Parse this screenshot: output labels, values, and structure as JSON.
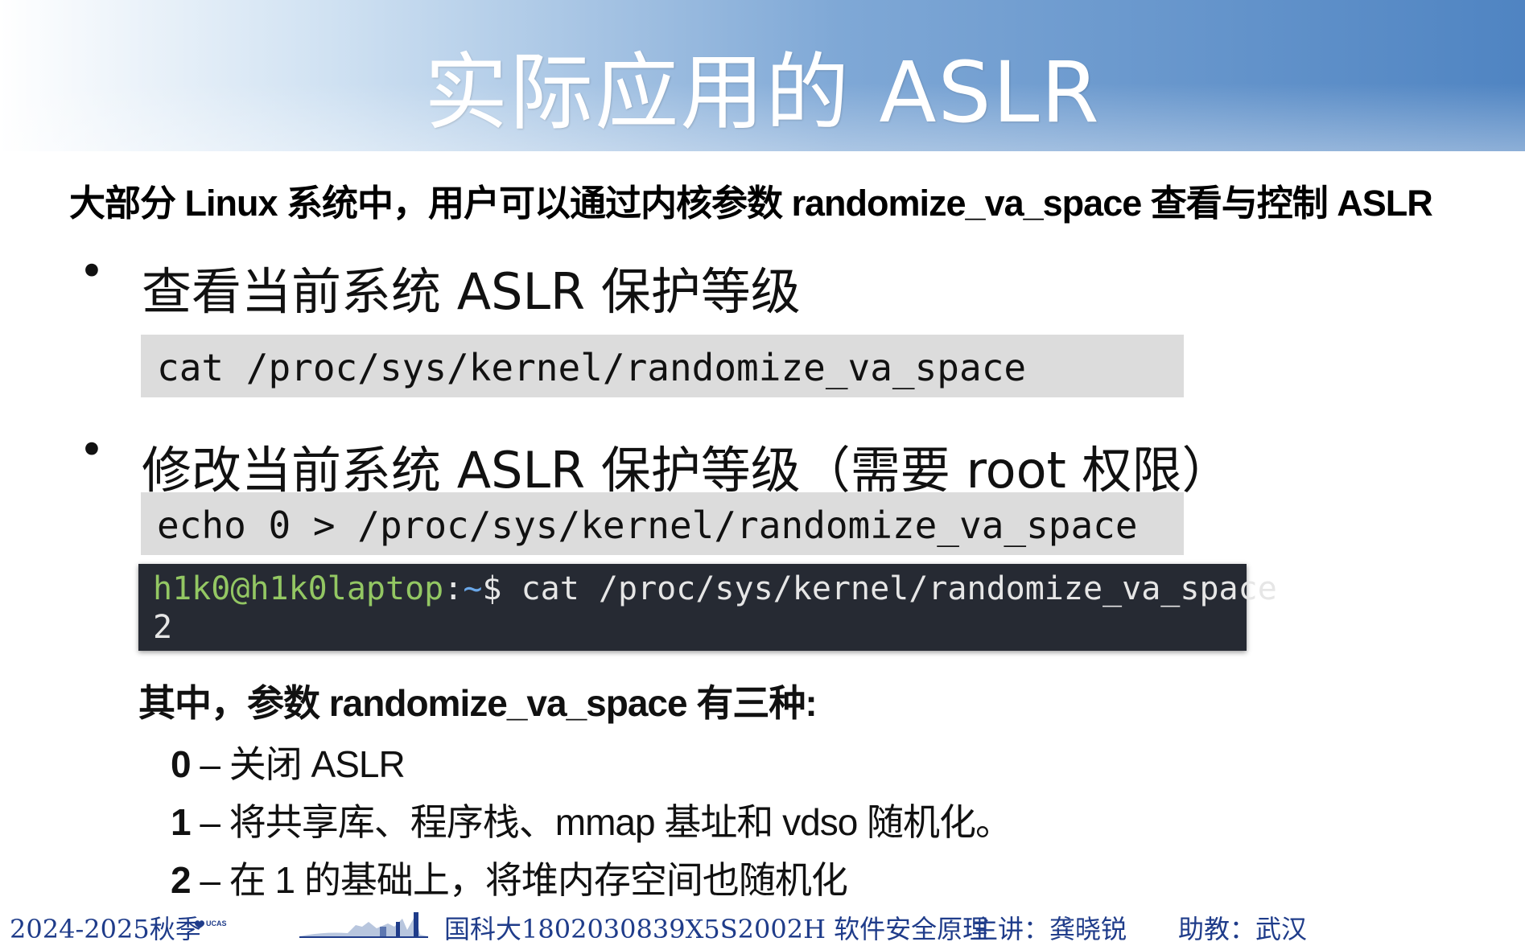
{
  "slide": {
    "title": "实际应用的 ASLR",
    "intro": "大部分 Linux 系统中，用户可以通过内核参数 randomize_va_space 查看与控制 ASLR",
    "bullets": [
      {
        "text": "查看当前系统 ASLR 保护等级",
        "code": "cat /proc/sys/kernel/randomize_va_space"
      },
      {
        "text": "修改当前系统 ASLR 保护等级（需要 root 权限）",
        "code": "echo 0 > /proc/sys/kernel/randomize_va_space"
      }
    ],
    "terminal": {
      "prompt_user": "h1k0@h1k0laptop",
      "prompt_sep": ":",
      "prompt_path": "~",
      "prompt_symbol": "$ ",
      "command": "cat /proc/sys/kernel/randomize_va_space",
      "output": "2"
    },
    "params_heading": "其中，参数 randomize_va_space 有三种:",
    "options": [
      {
        "num": "0",
        "dash": " – ",
        "desc": "关闭 ASLR"
      },
      {
        "num": "1",
        "dash": " – ",
        "desc": "将共享库、程序栈、mmap 基址和 vdso 随机化。"
      },
      {
        "num": "2",
        "dash": " – ",
        "desc": "在 1 的基础上，将堆内存空间也随机化"
      }
    ]
  },
  "footer": {
    "term": "2024-2025秋季",
    "logo_text": "UCAS",
    "course": "国科大1802030839X5S2002H  软件安全原理",
    "lecturer": "主讲：龚晓锐",
    "assistant": "助教：武汉"
  },
  "colors": {
    "header_blue": "#4f84c2",
    "code_bg": "#dcdcdc",
    "terminal_bg": "#262a33",
    "prompt_green": "#93c763",
    "prompt_blue": "#6aa7e8",
    "footer_text": "#1f3c8a"
  }
}
